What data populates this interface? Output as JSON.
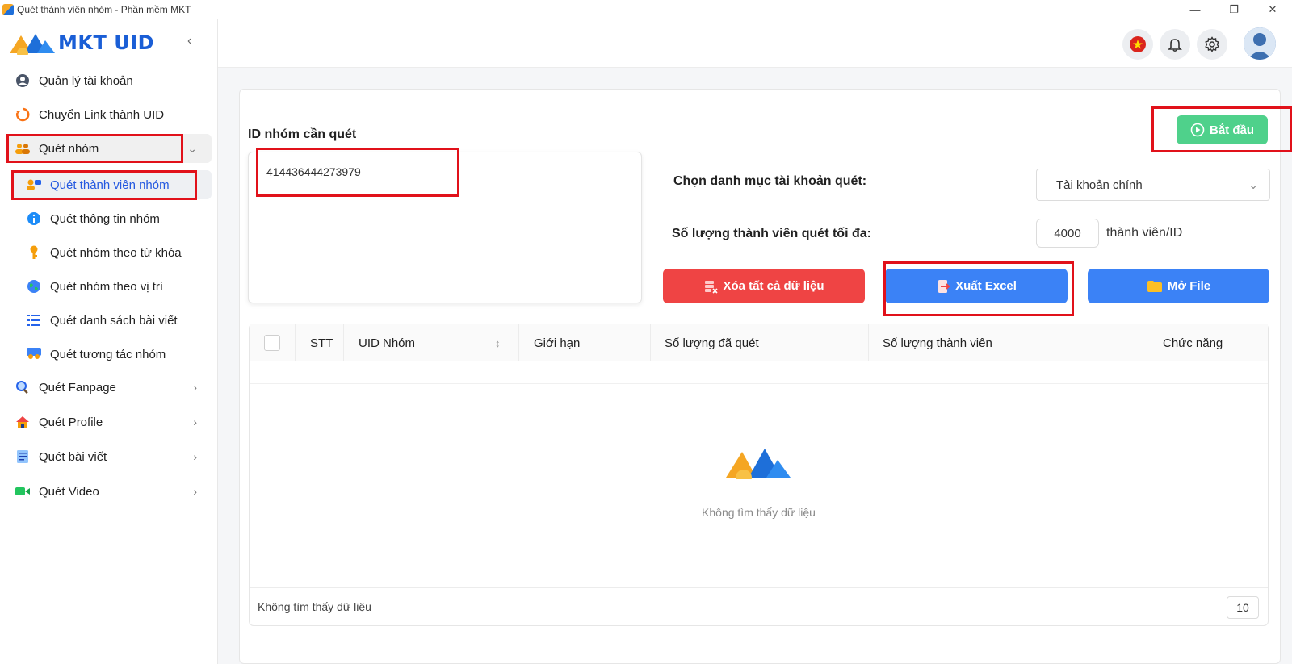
{
  "window": {
    "title": "Quét thành viên nhóm - Phần mềm MKT",
    "minimize": "—",
    "restore": "❐",
    "close": "✕"
  },
  "brand": {
    "name": "MKT UID",
    "color": "#1a5ed6"
  },
  "sidebar": {
    "collapse_icon": "‹",
    "items": [
      {
        "label": "Quản lý tài khoản",
        "icon": "user-circle-icon"
      },
      {
        "label": "Chuyển Link thành UID",
        "icon": "sync-icon"
      },
      {
        "label": "Quét nhóm",
        "icon": "group-icon",
        "expanded": true
      },
      {
        "label": "Quét Fanpage",
        "icon": "search-icon"
      },
      {
        "label": "Quét Profile",
        "icon": "house-icon"
      },
      {
        "label": "Quét bài viết",
        "icon": "document-icon"
      },
      {
        "label": "Quét Video",
        "icon": "video-icon"
      }
    ],
    "subitems": [
      {
        "label": "Quét thành viên nhóm",
        "icon": "members-icon",
        "active": true
      },
      {
        "label": "Quét thông tin nhóm",
        "icon": "info-icon"
      },
      {
        "label": "Quét nhóm theo từ khóa",
        "icon": "key-icon"
      },
      {
        "label": "Quét nhóm theo vị trí",
        "icon": "globe-icon"
      },
      {
        "label": "Quét danh sách bài viết",
        "icon": "list-icon"
      },
      {
        "label": "Quét tương tác nhóm",
        "icon": "interaction-icon"
      }
    ]
  },
  "main": {
    "id_label": "ID nhóm cần quét",
    "id_value": "414436444273979",
    "category_label": "Chọn danh mục tài khoản quét:",
    "category_value": "Tài khoản chính",
    "max_label": "Số lượng thành viên quét tối đa:",
    "max_value": "4000",
    "max_suffix": "thành viên/ID",
    "start_button": "Bắt đầu",
    "clear_button": "Xóa tất cả dữ liệu",
    "export_button": "Xuất Excel",
    "open_button": "Mở File"
  },
  "table": {
    "columns": [
      "STT",
      "UID Nhóm",
      "Giới hạn",
      "Số lượng đã quét",
      "Số lượng thành viên",
      "Chức năng"
    ],
    "empty_text": "Không tìm thấy dữ liệu",
    "footer_text": "Không tìm thấy dữ liệu",
    "page_size": "10"
  },
  "colors": {
    "start": "#4fd18b",
    "clear": "#ef4444",
    "primary": "#3b82f6",
    "highlight": "#e1111a",
    "active_text": "#2459e0"
  }
}
